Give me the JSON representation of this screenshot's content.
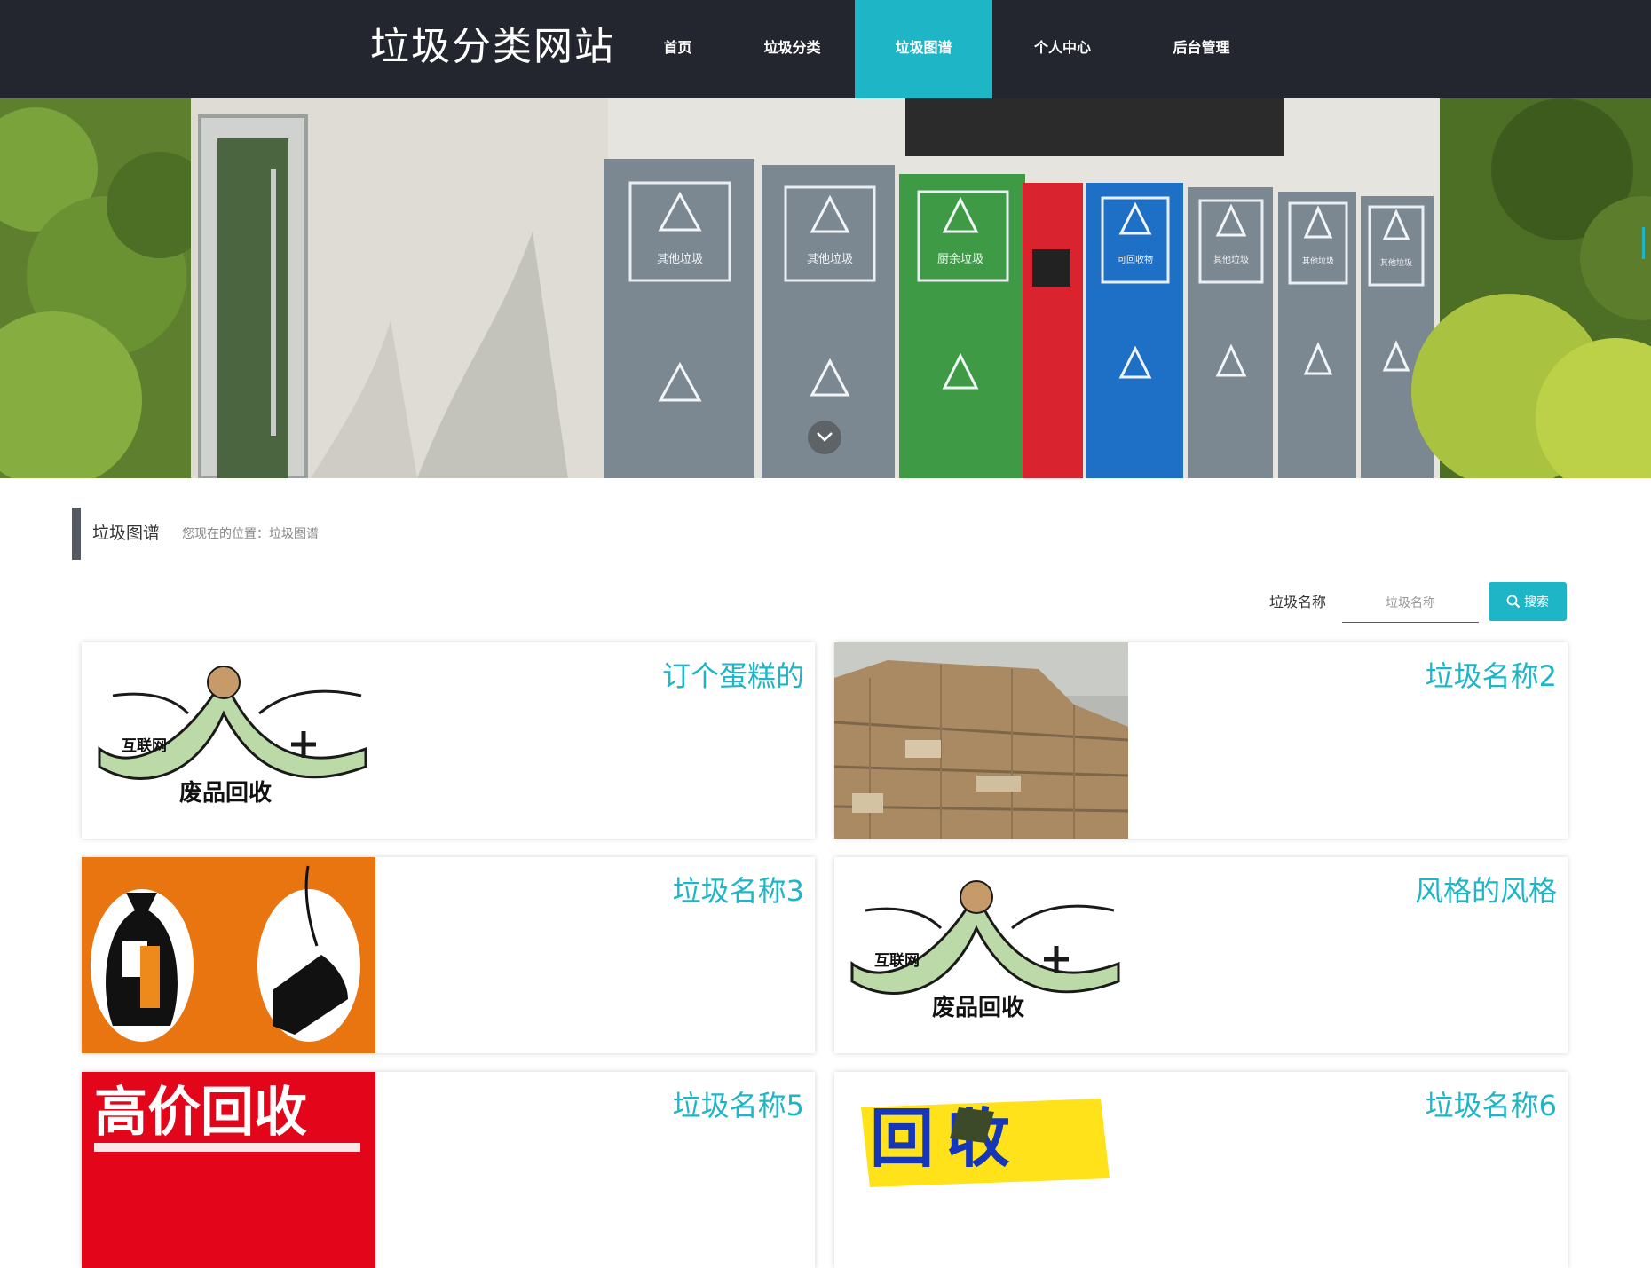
{
  "site": {
    "brand": "垃圾分类网站"
  },
  "nav": {
    "items": [
      {
        "label": "首页",
        "active": false
      },
      {
        "label": "垃圾分类",
        "active": false
      },
      {
        "label": "垃圾图谱",
        "active": true
      },
      {
        "label": "个人中心",
        "active": false
      },
      {
        "label": "后台管理",
        "active": false
      }
    ]
  },
  "hero": {
    "bin_labels": [
      "其他垃圾",
      "其他垃圾",
      "厨余垃圾",
      "可回收物",
      "其他垃圾",
      "其他垃圾",
      "其他垃圾"
    ]
  },
  "breadcrumb": {
    "title": "垃圾图谱",
    "location": "您现在的位置：垃圾图谱"
  },
  "search": {
    "label": "垃圾名称",
    "placeholder": "垃圾名称",
    "button_label": "搜索"
  },
  "cards": [
    {
      "title": "订个蛋糕的",
      "image_text": [
        "互联网",
        "废品回收"
      ]
    },
    {
      "title": "垃圾名称2",
      "image_text": []
    },
    {
      "title": "垃圾名称3",
      "image_text": []
    },
    {
      "title": "风格的风格",
      "image_text": [
        "互联网",
        "废品回收"
      ]
    },
    {
      "title": "垃圾名称5",
      "image_text": [
        "高价回收"
      ]
    },
    {
      "title": "垃圾名称6",
      "image_text": [
        "回收"
      ]
    }
  ],
  "colors": {
    "nav_bg": "#23252f",
    "accent": "#1eb5c6",
    "card_title": "#1eb5c6"
  }
}
